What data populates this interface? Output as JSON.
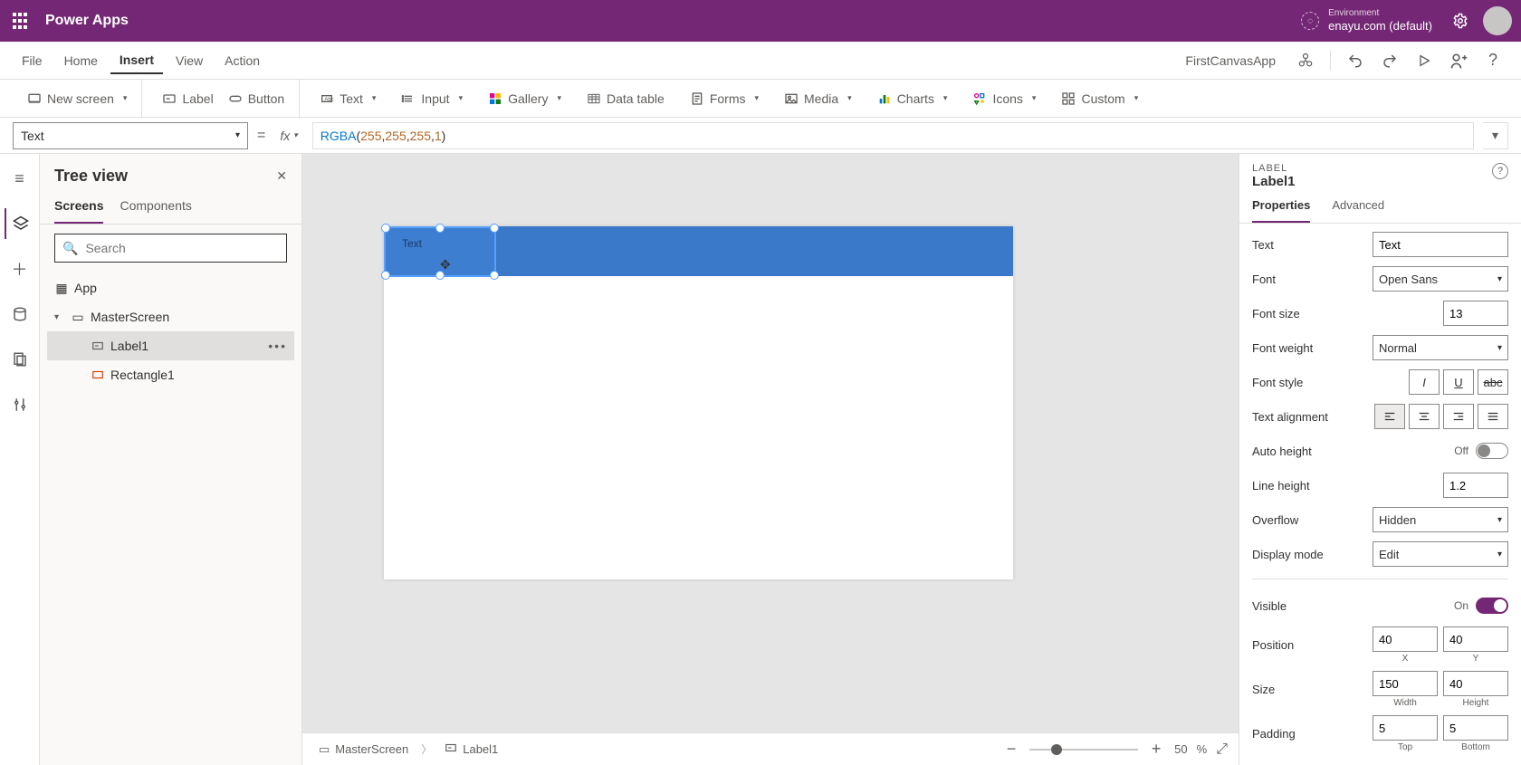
{
  "topbar": {
    "title": "Power Apps",
    "env_label": "Environment",
    "env_name": "enayu.com (default)"
  },
  "menubar": {
    "items": [
      "File",
      "Home",
      "Insert",
      "View",
      "Action"
    ],
    "active": "Insert",
    "app_name": "FirstCanvasApp"
  },
  "ribbon": {
    "new_screen": "New screen",
    "label": "Label",
    "button": "Button",
    "text": "Text",
    "input": "Input",
    "gallery": "Gallery",
    "data_table": "Data table",
    "forms": "Forms",
    "media": "Media",
    "charts": "Charts",
    "icons": "Icons",
    "custom": "Custom"
  },
  "formula": {
    "property": "Text",
    "fn": "RGBA",
    "args": [
      "255",
      "255",
      "255",
      "1"
    ]
  },
  "tree": {
    "title": "Tree view",
    "tabs": {
      "screens": "Screens",
      "components": "Components"
    },
    "search_placeholder": "Search",
    "app": "App",
    "screen": "MasterScreen",
    "label": "Label1",
    "rectangle": "Rectangle1"
  },
  "canvas": {
    "label_text": "Text"
  },
  "proppanel": {
    "type": "LABEL",
    "name": "Label1",
    "tabs": {
      "properties": "Properties",
      "advanced": "Advanced"
    },
    "rows": {
      "text_label": "Text",
      "text_value": "Text",
      "font_label": "Font",
      "font_value": "Open Sans",
      "fontsize_label": "Font size",
      "fontsize_value": "13",
      "fontweight_label": "Font weight",
      "fontweight_value": "Normal",
      "fontstyle_label": "Font style",
      "align_label": "Text alignment",
      "autoheight_label": "Auto height",
      "autoheight_state": "Off",
      "lineheight_label": "Line height",
      "lineheight_value": "1.2",
      "overflow_label": "Overflow",
      "overflow_value": "Hidden",
      "displaymode_label": "Display mode",
      "displaymode_value": "Edit",
      "visible_label": "Visible",
      "visible_state": "On",
      "position_label": "Position",
      "pos_x": "40",
      "pos_y": "40",
      "xlabel": "X",
      "ylabel": "Y",
      "size_label": "Size",
      "width": "150",
      "height": "40",
      "wlabel": "Width",
      "hlabel": "Height",
      "padding_label": "Padding",
      "pad_top": "5",
      "pad_bottom": "5",
      "toplabel": "Top",
      "bottomlabel": "Bottom"
    }
  },
  "status": {
    "crumb_screen": "MasterScreen",
    "crumb_label": "Label1",
    "zoom_value": "50",
    "zoom_pct": "%"
  }
}
